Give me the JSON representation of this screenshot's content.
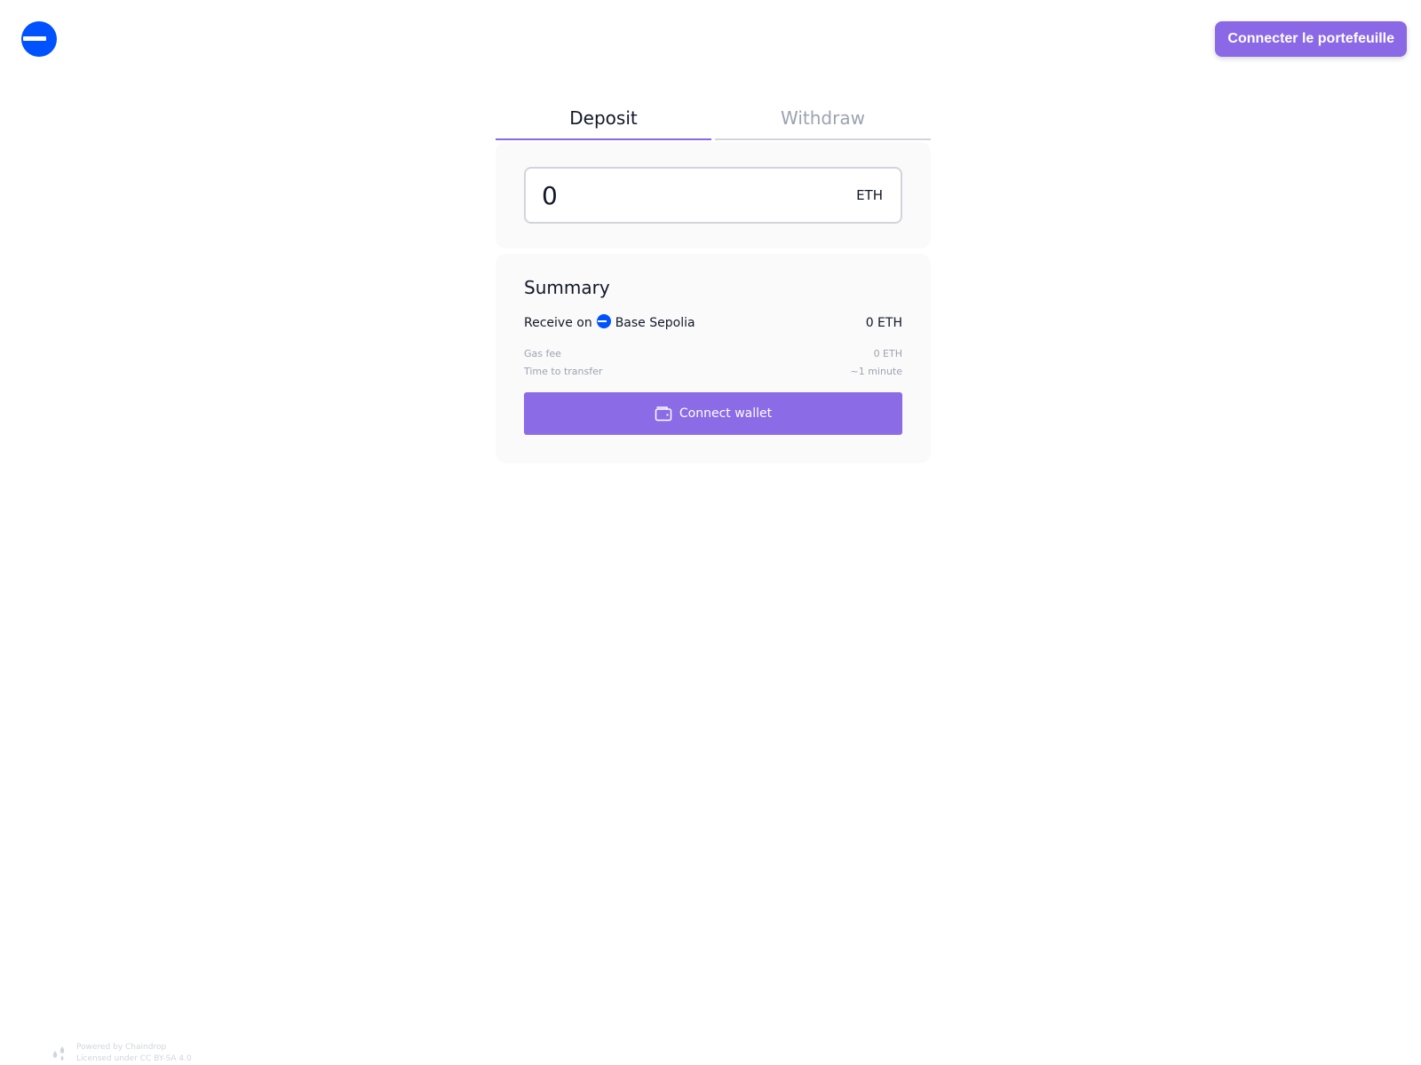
{
  "header": {
    "logo_icon": "base-logo-icon",
    "connect_label": "Connecter le portefeuille"
  },
  "tabs": [
    {
      "label": "Deposit",
      "active": true
    },
    {
      "label": "Withdraw",
      "active": false
    }
  ],
  "amount": {
    "value": "0",
    "currency": "ETH"
  },
  "summary": {
    "title": "Summary",
    "receive_prefix": "Receive on",
    "network_icon": "base-network-icon",
    "network_name": "Base Sepolia",
    "receive_value": "0 ETH",
    "details": [
      {
        "label": "Gas fee",
        "value": "0 ETH"
      },
      {
        "label": "Time to transfer",
        "value": "~1 minute"
      }
    ],
    "connect_label": "Connect wallet",
    "connect_icon": "wallet-icon"
  },
  "footer": {
    "line1": "Powered by Chaindrop",
    "line2": "Licensed under CC BY-SA 4.0",
    "icon": "chaindrop-logo-icon"
  },
  "colors": {
    "accent": "#8b68e6",
    "base_blue": "#0052ff",
    "card_bg": "#fafafa",
    "muted_text": "#9ca3af"
  }
}
